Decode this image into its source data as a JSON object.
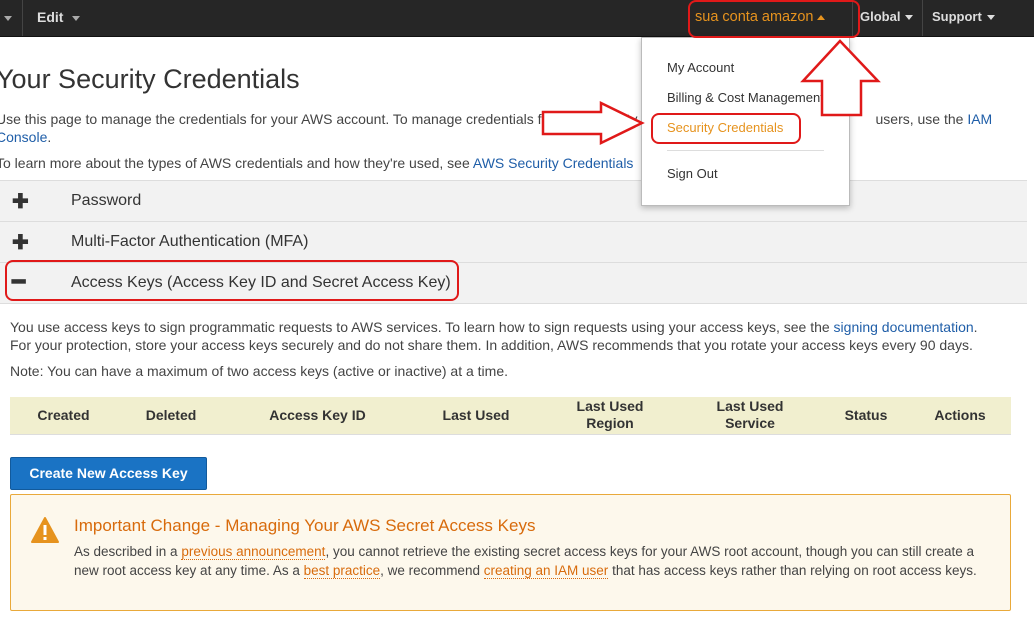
{
  "topbar": {
    "edit_label": "Edit",
    "account_label": "sua conta amazon",
    "region_label": "Global",
    "support_label": "Support"
  },
  "account_menu": {
    "items": [
      "My Account",
      "Billing & Cost Management",
      "Security Credentials",
      "Sign Out"
    ]
  },
  "page": {
    "title": "Your Security Credentials",
    "intro1_pre": "Use this page to manage the credentials for your AWS account. To manage credentials for AWS Identity",
    "intro1_post": "users, use the",
    "intro1_link1": "IAM",
    "intro1_link2": "Console",
    "intro1_end": ".",
    "intro2_pre": "To learn more about the types of AWS credentials and how they're used, see",
    "intro2_link": "AWS Security Credentials"
  },
  "sections": {
    "password": "Password",
    "mfa": "Multi-Factor Authentication (MFA)",
    "access_keys": "Access Keys (Access Key ID and Secret Access Key)"
  },
  "access_keys": {
    "para1_pre": "You use access keys to sign programmatic requests to AWS services. To learn how to sign requests using your access keys, see the",
    "para1_link": "signing documentation",
    "para1_end": ".",
    "para2": "For your protection, store your access keys securely and do not share them. In addition, AWS recommends that you rotate your access keys every 90 days.",
    "note": "Note: You can have a maximum of two access keys (active or inactive) at a time.",
    "columns": {
      "created": "Created",
      "deleted": "Deleted",
      "access_key_id": "Access Key ID",
      "last_used": "Last Used",
      "last_used_region_1": "Last Used",
      "last_used_region_2": "Region",
      "last_used_service_1": "Last Used",
      "last_used_service_2": "Service",
      "status": "Status",
      "actions": "Actions"
    },
    "create_button": "Create New Access Key"
  },
  "alert": {
    "title": "Important Change - Managing Your AWS Secret Access Keys",
    "t1": "As described in a",
    "l1": "previous announcement",
    "t2": ", you cannot retrieve the existing secret access keys for your AWS root account, though you can still create a new root access key at any time. As a",
    "l2": "best practice",
    "t3": ", we recommend",
    "l3": "creating an IAM user",
    "t4": "that has access keys rather than relying on root access keys."
  },
  "colors": {
    "topbar": "#262626",
    "accent_orange": "#e6931e",
    "link_blue": "#1f5ea8",
    "annotation_red": "#e01919",
    "button_blue": "#1a73c4"
  },
  "icons": {
    "menu_chevron": "chevron-down-icon",
    "expand": "plus-icon",
    "collapse": "minus-icon",
    "warning": "warning-triangle-icon"
  }
}
